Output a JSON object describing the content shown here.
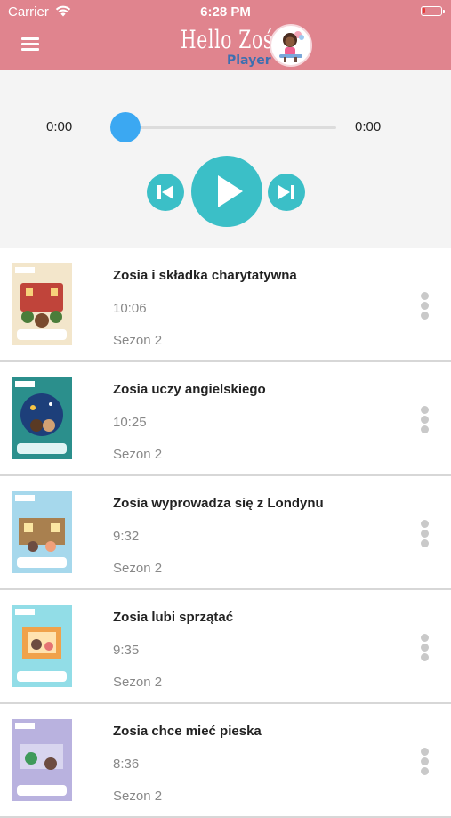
{
  "status_bar": {
    "carrier": "Carrier",
    "time": "6:28 PM"
  },
  "header": {
    "logo_title": "Hello Zoś",
    "logo_subtitle": "Player",
    "menu_icon": "hamburger-menu-icon",
    "colors": {
      "header_bg": "#e0848e",
      "accent": "#3bbfc7",
      "slider": "#3ba8f2"
    }
  },
  "player": {
    "current_time": "0:00",
    "total_time": "0:00",
    "progress": 0,
    "icons": {
      "prev": "skip-previous-icon",
      "play": "play-icon",
      "next": "skip-next-icon"
    }
  },
  "episodes": [
    {
      "title": "Zosia i składka charytatywna",
      "duration": "10:06",
      "season": "Sezon 2",
      "cover_color": "#f2e7cf"
    },
    {
      "title": "Zosia uczy angielskiego",
      "duration": "10:25",
      "season": "Sezon 2",
      "cover_color": "#2a8c8a"
    },
    {
      "title": "Zosia wyprowadza się z Londynu",
      "duration": "9:32",
      "season": "Sezon 2",
      "cover_color": "#9bd3e8"
    },
    {
      "title": "Zosia lubi sprzątać",
      "duration": "9:35",
      "season": "Sezon 2",
      "cover_color": "#8fdbe6"
    },
    {
      "title": "Zosia chce mieć pieska",
      "duration": "8:36",
      "season": "Sezon 2",
      "cover_color": "#b7b0de"
    }
  ]
}
